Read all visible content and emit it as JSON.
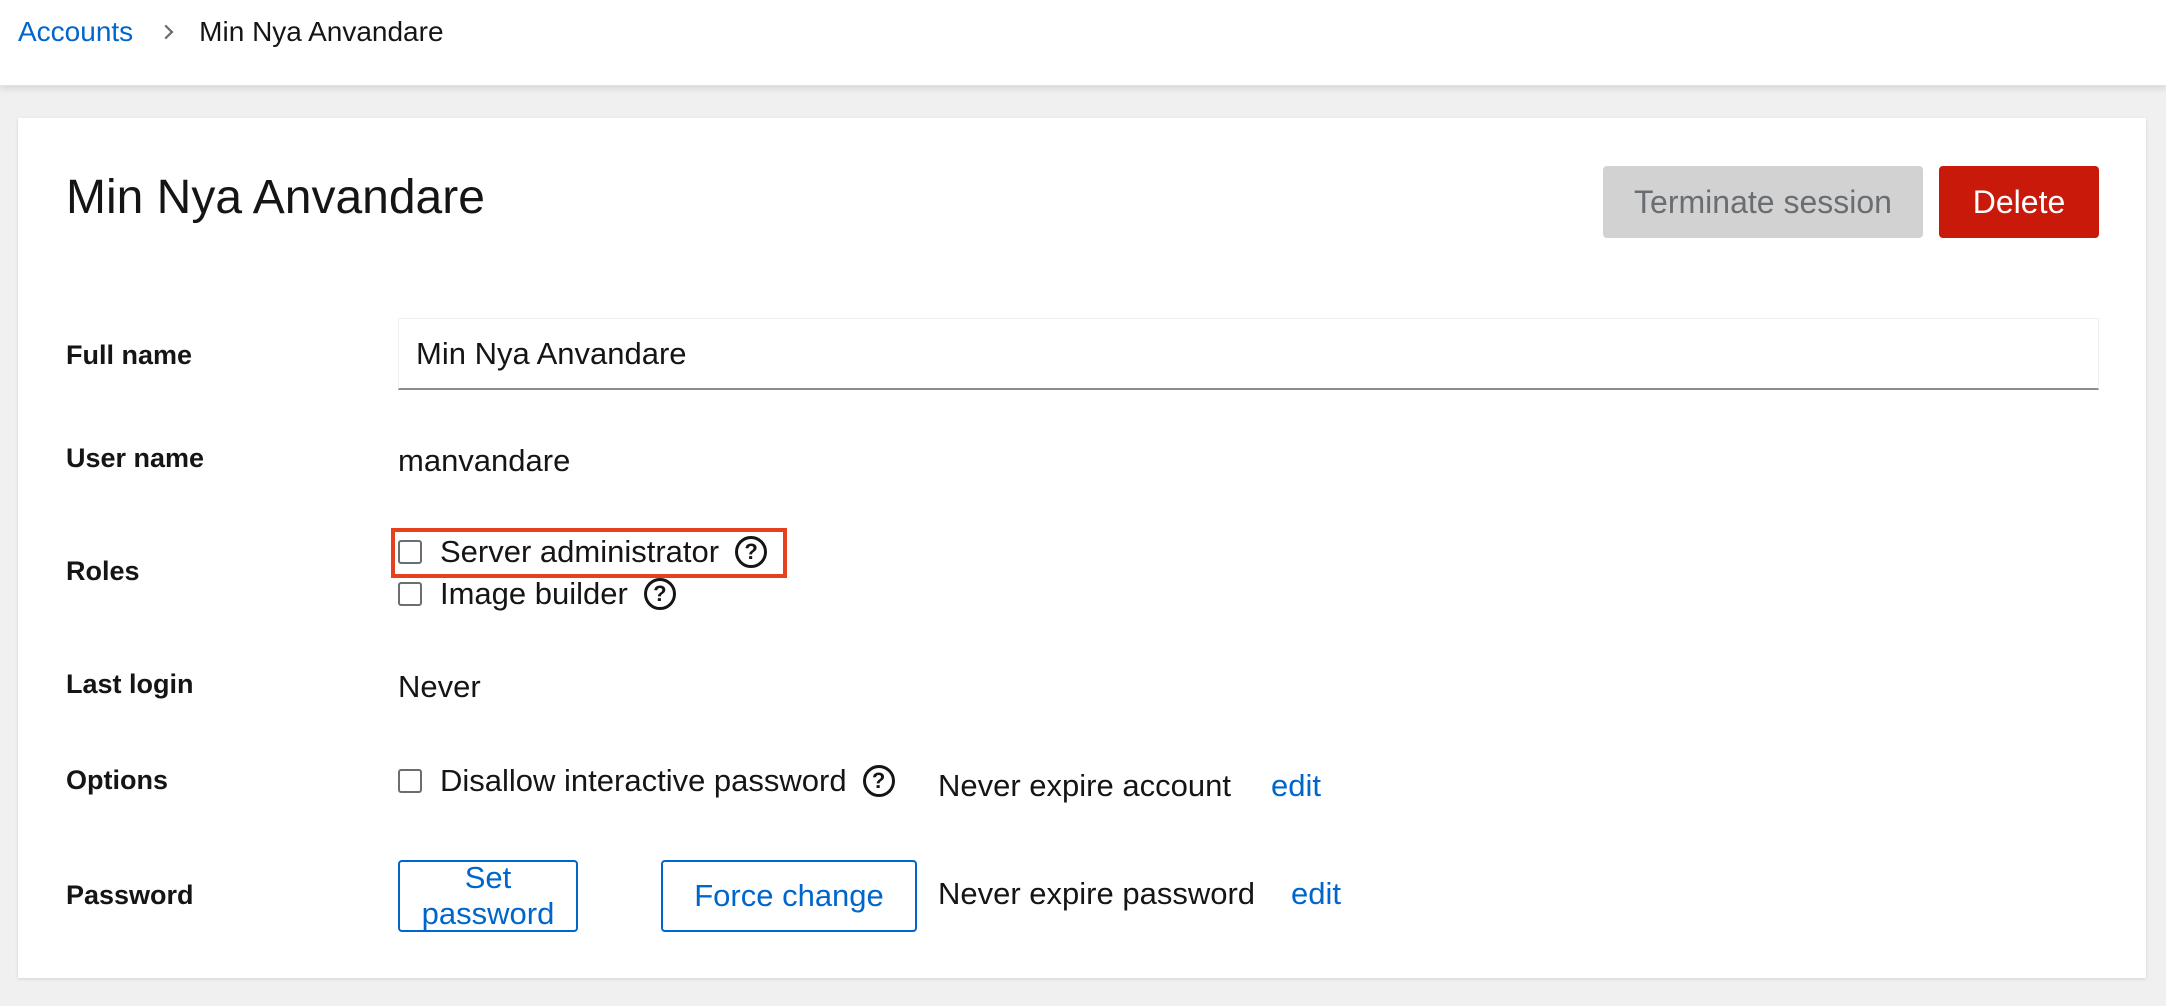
{
  "breadcrumb": {
    "parent": "Accounts",
    "current": "Min Nya Anvandare"
  },
  "page": {
    "title": "Min Nya Anvandare"
  },
  "actions": {
    "terminate_label": "Terminate session",
    "delete_label": "Delete"
  },
  "fields": {
    "full_name": {
      "label": "Full name",
      "value": "Min Nya Anvandare"
    },
    "user_name": {
      "label": "User name",
      "value": "manvandare"
    },
    "roles": {
      "label": "Roles",
      "items": [
        {
          "label": "Server administrator",
          "checked": false
        },
        {
          "label": "Image builder",
          "checked": false
        }
      ]
    },
    "last_login": {
      "label": "Last login",
      "value": "Never"
    },
    "options": {
      "label": "Options",
      "disallow_label": "Disallow interactive password",
      "expire_text": "Never expire account",
      "edit_label": "edit"
    },
    "password": {
      "label": "Password",
      "set_label": "Set password",
      "force_label": "Force change",
      "expire_text": "Never expire password",
      "edit_label": "edit"
    }
  },
  "icons": {
    "help": "question-circle-icon",
    "chevron": "chevron-right-icon"
  },
  "colors": {
    "link": "#0066cc",
    "danger": "#c9190b",
    "disabled_bg": "#d2d2d2",
    "highlight": "#e8401c"
  }
}
